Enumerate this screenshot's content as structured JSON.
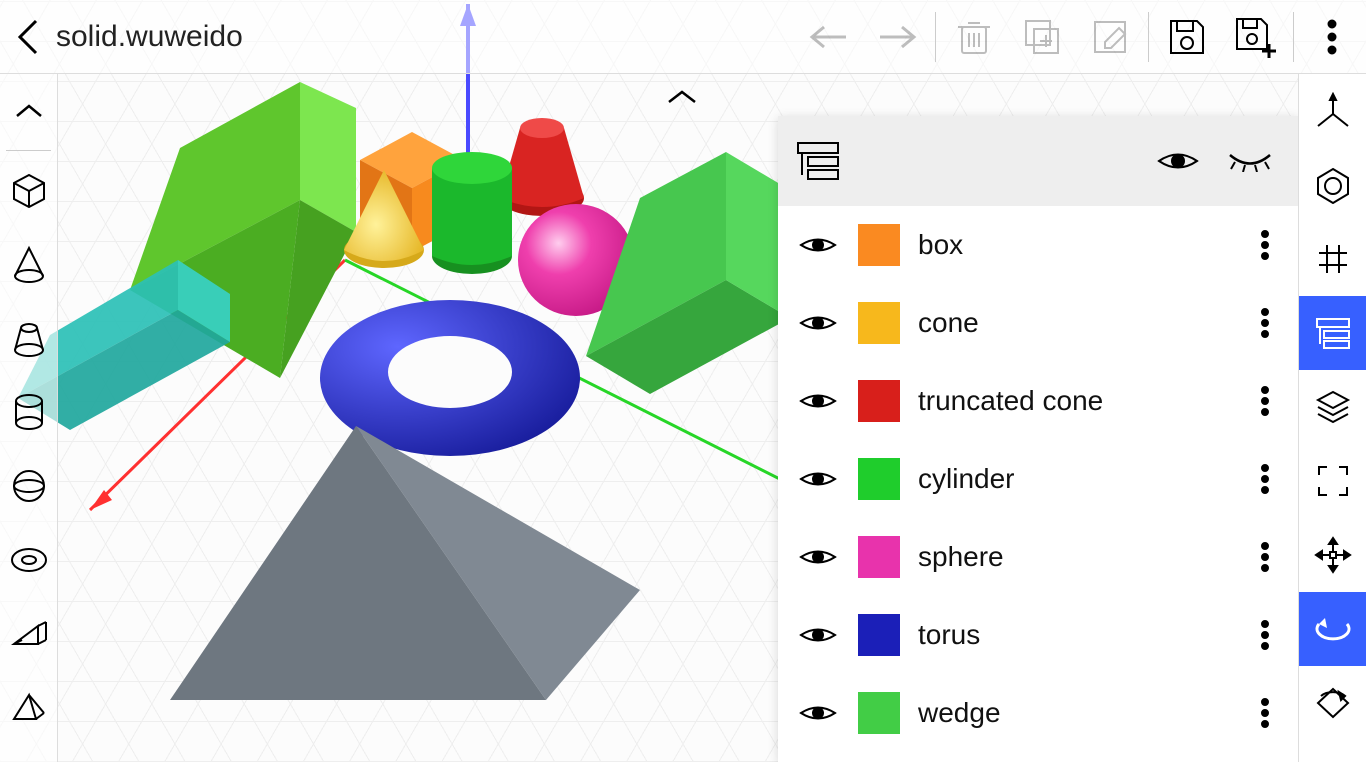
{
  "header": {
    "filename": "solid.wuweido"
  },
  "objects_panel": {
    "items": [
      {
        "label": "box",
        "color": "#fa8a21"
      },
      {
        "label": "cone",
        "color": "#f7b81c"
      },
      {
        "label": "truncated cone",
        "color": "#d81f1b"
      },
      {
        "label": "cylinder",
        "color": "#1fcd2c"
      },
      {
        "label": "sphere",
        "color": "#e833ac"
      },
      {
        "label": "torus",
        "color": "#1b1fb8"
      },
      {
        "label": "wedge",
        "color": "#42cd46"
      }
    ]
  },
  "scene": {
    "axes": {
      "x": "#ff2a2a",
      "y": "#2aff2a",
      "z": "#4a4aff"
    },
    "shapes": [
      {
        "name": "wedge-green-left",
        "color": "#56c32b"
      },
      {
        "name": "wedge-teal",
        "color": "#24b5ac"
      },
      {
        "name": "box-orange",
        "color": "#f7861a"
      },
      {
        "name": "cone-yellow",
        "color": "#f4c61e"
      },
      {
        "name": "truncated-cone-red",
        "color": "#d31f1e"
      },
      {
        "name": "cylinder-green",
        "color": "#1bb82c"
      },
      {
        "name": "sphere-magenta",
        "color": "#e62f9d"
      },
      {
        "name": "torus-blue",
        "color": "#1c22c9"
      },
      {
        "name": "pyramid-gray",
        "color": "#6e7780"
      },
      {
        "name": "wedge-green-right",
        "color": "#3dbb46"
      }
    ]
  }
}
